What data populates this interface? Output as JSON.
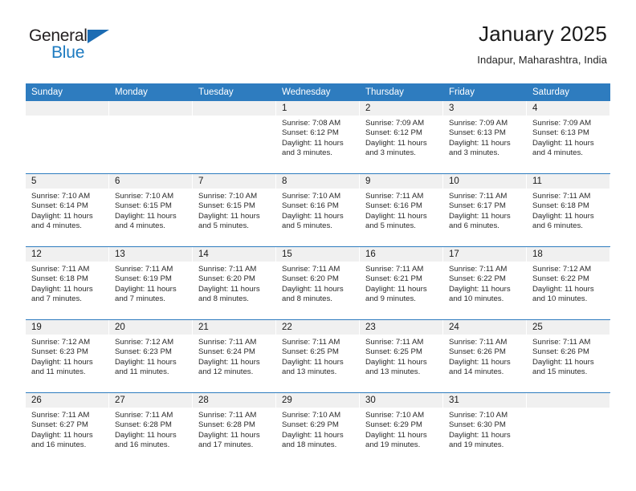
{
  "brand": {
    "logo_primary": "General",
    "logo_secondary": "Blue",
    "triangle_icon": "blue-triangle-icon",
    "accent_color": "#2e7cbf"
  },
  "header": {
    "title": "January 2025",
    "location": "Indapur, Maharashtra, India"
  },
  "calendar": {
    "weekday_headers": [
      "Sunday",
      "Monday",
      "Tuesday",
      "Wednesday",
      "Thursday",
      "Friday",
      "Saturday"
    ],
    "header_bg": "#2e7cbf",
    "daynum_bg": "#f0f0f0",
    "weeks": [
      [
        {
          "day": "",
          "empty": true
        },
        {
          "day": "",
          "empty": true
        },
        {
          "day": "",
          "empty": true
        },
        {
          "day": "1",
          "sunrise": "Sunrise: 7:08 AM",
          "sunset": "Sunset: 6:12 PM",
          "daylight1": "Daylight: 11 hours",
          "daylight2": "and 3 minutes."
        },
        {
          "day": "2",
          "sunrise": "Sunrise: 7:09 AM",
          "sunset": "Sunset: 6:12 PM",
          "daylight1": "Daylight: 11 hours",
          "daylight2": "and 3 minutes."
        },
        {
          "day": "3",
          "sunrise": "Sunrise: 7:09 AM",
          "sunset": "Sunset: 6:13 PM",
          "daylight1": "Daylight: 11 hours",
          "daylight2": "and 3 minutes."
        },
        {
          "day": "4",
          "sunrise": "Sunrise: 7:09 AM",
          "sunset": "Sunset: 6:13 PM",
          "daylight1": "Daylight: 11 hours",
          "daylight2": "and 4 minutes."
        }
      ],
      [
        {
          "day": "5",
          "sunrise": "Sunrise: 7:10 AM",
          "sunset": "Sunset: 6:14 PM",
          "daylight1": "Daylight: 11 hours",
          "daylight2": "and 4 minutes."
        },
        {
          "day": "6",
          "sunrise": "Sunrise: 7:10 AM",
          "sunset": "Sunset: 6:15 PM",
          "daylight1": "Daylight: 11 hours",
          "daylight2": "and 4 minutes."
        },
        {
          "day": "7",
          "sunrise": "Sunrise: 7:10 AM",
          "sunset": "Sunset: 6:15 PM",
          "daylight1": "Daylight: 11 hours",
          "daylight2": "and 5 minutes."
        },
        {
          "day": "8",
          "sunrise": "Sunrise: 7:10 AM",
          "sunset": "Sunset: 6:16 PM",
          "daylight1": "Daylight: 11 hours",
          "daylight2": "and 5 minutes."
        },
        {
          "day": "9",
          "sunrise": "Sunrise: 7:11 AM",
          "sunset": "Sunset: 6:16 PM",
          "daylight1": "Daylight: 11 hours",
          "daylight2": "and 5 minutes."
        },
        {
          "day": "10",
          "sunrise": "Sunrise: 7:11 AM",
          "sunset": "Sunset: 6:17 PM",
          "daylight1": "Daylight: 11 hours",
          "daylight2": "and 6 minutes."
        },
        {
          "day": "11",
          "sunrise": "Sunrise: 7:11 AM",
          "sunset": "Sunset: 6:18 PM",
          "daylight1": "Daylight: 11 hours",
          "daylight2": "and 6 minutes."
        }
      ],
      [
        {
          "day": "12",
          "sunrise": "Sunrise: 7:11 AM",
          "sunset": "Sunset: 6:18 PM",
          "daylight1": "Daylight: 11 hours",
          "daylight2": "and 7 minutes."
        },
        {
          "day": "13",
          "sunrise": "Sunrise: 7:11 AM",
          "sunset": "Sunset: 6:19 PM",
          "daylight1": "Daylight: 11 hours",
          "daylight2": "and 7 minutes."
        },
        {
          "day": "14",
          "sunrise": "Sunrise: 7:11 AM",
          "sunset": "Sunset: 6:20 PM",
          "daylight1": "Daylight: 11 hours",
          "daylight2": "and 8 minutes."
        },
        {
          "day": "15",
          "sunrise": "Sunrise: 7:11 AM",
          "sunset": "Sunset: 6:20 PM",
          "daylight1": "Daylight: 11 hours",
          "daylight2": "and 8 minutes."
        },
        {
          "day": "16",
          "sunrise": "Sunrise: 7:11 AM",
          "sunset": "Sunset: 6:21 PM",
          "daylight1": "Daylight: 11 hours",
          "daylight2": "and 9 minutes."
        },
        {
          "day": "17",
          "sunrise": "Sunrise: 7:11 AM",
          "sunset": "Sunset: 6:22 PM",
          "daylight1": "Daylight: 11 hours",
          "daylight2": "and 10 minutes."
        },
        {
          "day": "18",
          "sunrise": "Sunrise: 7:12 AM",
          "sunset": "Sunset: 6:22 PM",
          "daylight1": "Daylight: 11 hours",
          "daylight2": "and 10 minutes."
        }
      ],
      [
        {
          "day": "19",
          "sunrise": "Sunrise: 7:12 AM",
          "sunset": "Sunset: 6:23 PM",
          "daylight1": "Daylight: 11 hours",
          "daylight2": "and 11 minutes."
        },
        {
          "day": "20",
          "sunrise": "Sunrise: 7:12 AM",
          "sunset": "Sunset: 6:23 PM",
          "daylight1": "Daylight: 11 hours",
          "daylight2": "and 11 minutes."
        },
        {
          "day": "21",
          "sunrise": "Sunrise: 7:11 AM",
          "sunset": "Sunset: 6:24 PM",
          "daylight1": "Daylight: 11 hours",
          "daylight2": "and 12 minutes."
        },
        {
          "day": "22",
          "sunrise": "Sunrise: 7:11 AM",
          "sunset": "Sunset: 6:25 PM",
          "daylight1": "Daylight: 11 hours",
          "daylight2": "and 13 minutes."
        },
        {
          "day": "23",
          "sunrise": "Sunrise: 7:11 AM",
          "sunset": "Sunset: 6:25 PM",
          "daylight1": "Daylight: 11 hours",
          "daylight2": "and 13 minutes."
        },
        {
          "day": "24",
          "sunrise": "Sunrise: 7:11 AM",
          "sunset": "Sunset: 6:26 PM",
          "daylight1": "Daylight: 11 hours",
          "daylight2": "and 14 minutes."
        },
        {
          "day": "25",
          "sunrise": "Sunrise: 7:11 AM",
          "sunset": "Sunset: 6:26 PM",
          "daylight1": "Daylight: 11 hours",
          "daylight2": "and 15 minutes."
        }
      ],
      [
        {
          "day": "26",
          "sunrise": "Sunrise: 7:11 AM",
          "sunset": "Sunset: 6:27 PM",
          "daylight1": "Daylight: 11 hours",
          "daylight2": "and 16 minutes."
        },
        {
          "day": "27",
          "sunrise": "Sunrise: 7:11 AM",
          "sunset": "Sunset: 6:28 PM",
          "daylight1": "Daylight: 11 hours",
          "daylight2": "and 16 minutes."
        },
        {
          "day": "28",
          "sunrise": "Sunrise: 7:11 AM",
          "sunset": "Sunset: 6:28 PM",
          "daylight1": "Daylight: 11 hours",
          "daylight2": "and 17 minutes."
        },
        {
          "day": "29",
          "sunrise": "Sunrise: 7:10 AM",
          "sunset": "Sunset: 6:29 PM",
          "daylight1": "Daylight: 11 hours",
          "daylight2": "and 18 minutes."
        },
        {
          "day": "30",
          "sunrise": "Sunrise: 7:10 AM",
          "sunset": "Sunset: 6:29 PM",
          "daylight1": "Daylight: 11 hours",
          "daylight2": "and 19 minutes."
        },
        {
          "day": "31",
          "sunrise": "Sunrise: 7:10 AM",
          "sunset": "Sunset: 6:30 PM",
          "daylight1": "Daylight: 11 hours",
          "daylight2": "and 19 minutes."
        },
        {
          "day": "",
          "empty": true
        }
      ]
    ]
  }
}
